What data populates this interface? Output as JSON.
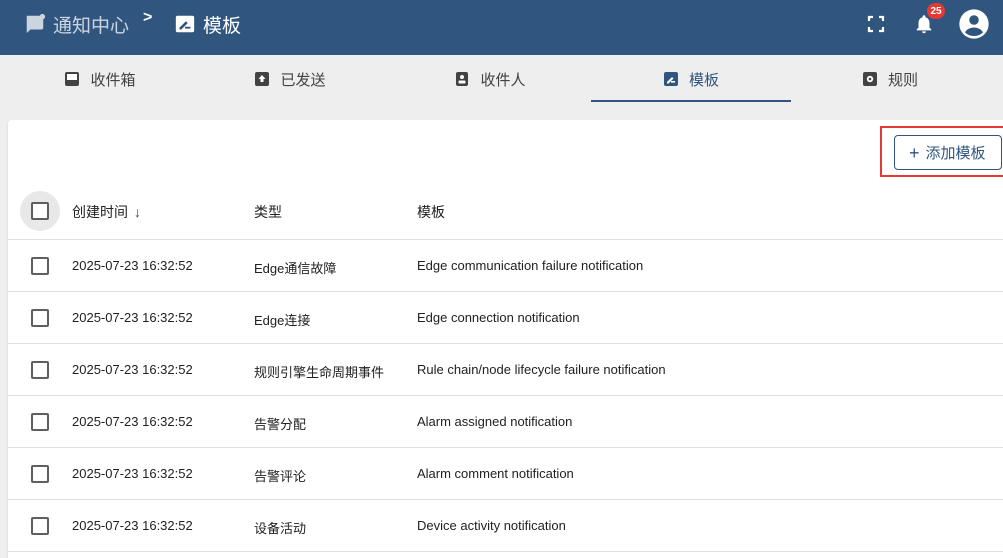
{
  "header": {
    "breadcrumb_root": "通知中心",
    "breadcrumb_sep": ">",
    "breadcrumb_current": "模板",
    "notification_count": "25"
  },
  "tabs": [
    {
      "label": "收件箱",
      "icon": "inbox-icon"
    },
    {
      "label": "已发送",
      "icon": "sent-icon"
    },
    {
      "label": "收件人",
      "icon": "recipients-icon"
    },
    {
      "label": "模板",
      "icon": "template-icon",
      "active": true
    },
    {
      "label": "规则",
      "icon": "rules-icon"
    }
  ],
  "toolbar": {
    "add_label": "添加模板"
  },
  "table": {
    "columns": [
      "创建时间",
      "类型",
      "模板"
    ],
    "rows": [
      {
        "created": "2025-07-23 16:32:52",
        "type": "Edge通信故障",
        "template": "Edge communication failure notification"
      },
      {
        "created": "2025-07-23 16:32:52",
        "type": "Edge连接",
        "template": "Edge connection notification"
      },
      {
        "created": "2025-07-23 16:32:52",
        "type": "规则引擎生命周期事件",
        "template": "Rule chain/node lifecycle failure notification"
      },
      {
        "created": "2025-07-23 16:32:52",
        "type": "告警分配",
        "template": "Alarm assigned notification"
      },
      {
        "created": "2025-07-23 16:32:52",
        "type": "告警评论",
        "template": "Alarm comment notification"
      },
      {
        "created": "2025-07-23 16:32:52",
        "type": "设备活动",
        "template": "Device activity notification"
      }
    ]
  },
  "colors": {
    "primary": "#305680",
    "badge": "#e53935",
    "highlight": "#e53935"
  }
}
